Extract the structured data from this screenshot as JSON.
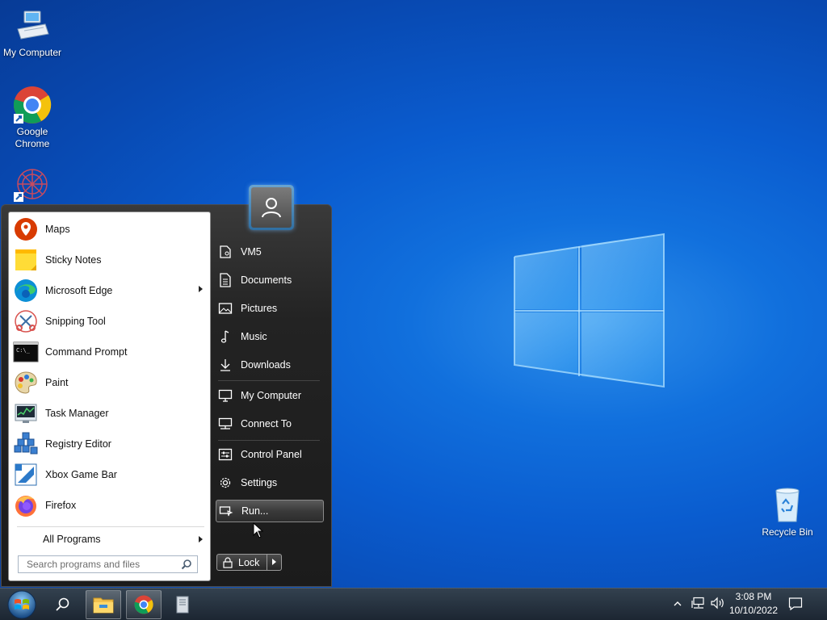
{
  "desktop": {
    "icons": [
      {
        "label": "My Computer",
        "icon": "computer-icon"
      },
      {
        "label": "Google Chrome",
        "icon": "chrome-icon"
      },
      {
        "label": "",
        "icon": "app-shortcut-icon"
      },
      {
        "label": "Recycle Bin",
        "icon": "recycle-bin-icon"
      }
    ]
  },
  "start_menu": {
    "programs": [
      {
        "label": "Maps",
        "icon": "maps-icon"
      },
      {
        "label": "Sticky Notes",
        "icon": "sticky-notes-icon"
      },
      {
        "label": "Microsoft Edge",
        "icon": "edge-icon",
        "submenu": true
      },
      {
        "label": "Snipping Tool",
        "icon": "snipping-tool-icon"
      },
      {
        "label": "Command Prompt",
        "icon": "cmd-icon"
      },
      {
        "label": "Paint",
        "icon": "paint-icon"
      },
      {
        "label": "Task Manager",
        "icon": "task-manager-icon"
      },
      {
        "label": "Registry Editor",
        "icon": "registry-icon"
      },
      {
        "label": "Xbox Game Bar",
        "icon": "xbox-icon"
      },
      {
        "label": "Firefox",
        "icon": "firefox-icon"
      }
    ],
    "all_programs": "All Programs",
    "search_placeholder": "Search programs and files",
    "right_items": [
      {
        "label": "VM5",
        "icon": "user-folder-icon"
      },
      {
        "label": "Documents",
        "icon": "documents-icon"
      },
      {
        "label": "Pictures",
        "icon": "pictures-icon"
      },
      {
        "label": "Music",
        "icon": "music-icon"
      },
      {
        "label": "Downloads",
        "icon": "downloads-icon"
      },
      {
        "label": "My Computer",
        "icon": "computer-icon"
      },
      {
        "label": "Connect To",
        "icon": "connect-icon"
      },
      {
        "label": "Control Panel",
        "icon": "control-panel-icon"
      },
      {
        "label": "Settings",
        "icon": "settings-icon"
      },
      {
        "label": "Run...",
        "icon": "run-icon",
        "hovered": true
      }
    ],
    "lock_label": "Lock"
  },
  "taskbar": {
    "time": "3:08 PM",
    "date": "10/10/2022"
  },
  "colors": {
    "desktop_blue": "#0a5ccf",
    "menu_dark": "#1b1b1b",
    "taskbar": "#1c2632"
  }
}
